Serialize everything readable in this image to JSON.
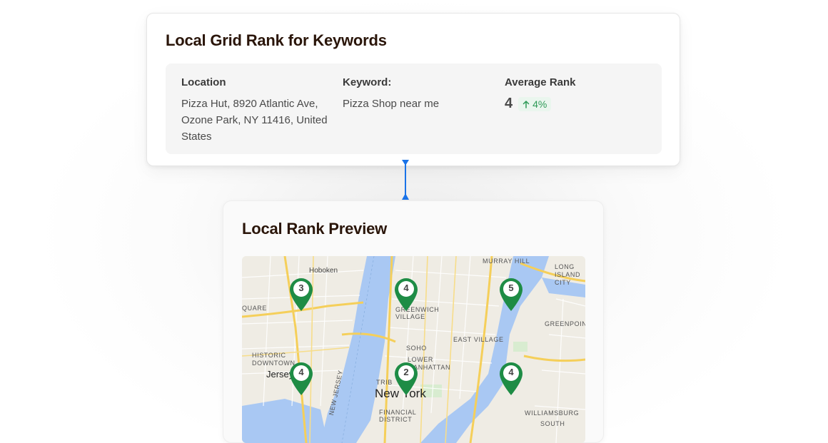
{
  "top_card": {
    "title": "Local Grid Rank for Keywords",
    "location_label": "Location",
    "location_value": "Pizza Hut, 8920 Atlantic Ave, Ozone Park, NY 11416, United States",
    "keyword_label": "Keyword:",
    "keyword_value": "Pizza Shop near me",
    "avg_rank_label": "Average Rank",
    "avg_rank_value": "4",
    "avg_rank_change": "4%",
    "change_direction": "up",
    "change_color": "#2e9a57"
  },
  "bottom_card": {
    "title": "Local Rank Preview",
    "map_labels": {
      "hoboken": "Hoboken",
      "long_island_city": "LONG ISLAND CITY",
      "greenwich_village": "GREENWICH VILLAGE",
      "quare": "QUARE",
      "greenpoint": "GREENPOIN",
      "east_village": "EAST VILLAGE",
      "historic_downtown": "HISTORIC DOWNTOWN",
      "soho": "SOHO",
      "lower_manhattan": "LOWER MANHATTAN",
      "jersey_city": "Jersey City",
      "new_york": "New York",
      "financial_district": "FINANCIAL DISTRICT",
      "williamsburg": "WILLIAMSBURG",
      "south": "SOUTH",
      "tribeca": "TRIB",
      "murray_hill": "MURRAY HILL",
      "new_jersey_tpk": "NEW JERSEY"
    },
    "pins": [
      {
        "rank": "3"
      },
      {
        "rank": "4"
      },
      {
        "rank": "5"
      },
      {
        "rank": "4"
      },
      {
        "rank": "2"
      },
      {
        "rank": "4"
      }
    ],
    "pin_color": "#1e8c45"
  }
}
